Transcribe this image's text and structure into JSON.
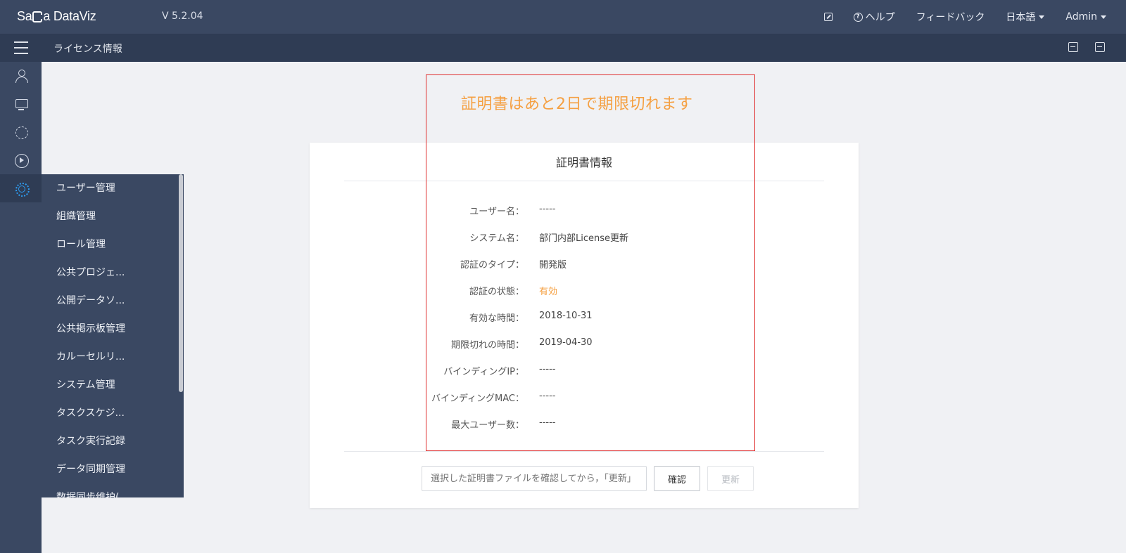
{
  "header": {
    "logo_text_pre": "Sa",
    "logo_text_post": "a DataViz",
    "version": "V 5.2.04",
    "help": "ヘルプ",
    "feedback": "フィードバック",
    "language": "日本語",
    "user": "Admin"
  },
  "subheader": {
    "breadcrumb": "ライセンス情報"
  },
  "rail": {
    "icons": [
      "user-icon",
      "monitor-icon",
      "cycle-icon",
      "play-icon",
      "gear-icon"
    ],
    "active": "gear-icon",
    "accent_color": "#2e9cf0"
  },
  "submenu": {
    "items": [
      "ユーザー管理",
      "組織管理",
      "ロール管理",
      "公共プロジェ...",
      "公開データソ...",
      "公共掲示板管理",
      "カルーセルリ...",
      "システム管理",
      "タスクスケジ...",
      "タスク実行記録",
      "データ同期管理",
      "数据同步维护(..."
    ]
  },
  "warning": {
    "text": "証明書はあと2日で期限切れます",
    "color": "#f5a042"
  },
  "certificate": {
    "title": "証明書情報",
    "rows": [
      {
        "label": "ユーザー名：",
        "value": "-----"
      },
      {
        "label": "システム名：",
        "value": "部门内部License更新"
      },
      {
        "label": "認証のタイプ：",
        "value": "開発版"
      },
      {
        "label": "認証の状態：",
        "value": "有効"
      },
      {
        "label": "有効な時間：",
        "value": "2018-10-31"
      },
      {
        "label": "期限切れの時間：",
        "value": "2019-04-30"
      },
      {
        "label": "バインディングIP：",
        "value": "-----"
      },
      {
        "label": "バインディングMAC：",
        "value": "-----"
      },
      {
        "label": "最大ユーザー数：",
        "value": "-----"
      }
    ],
    "file_placeholder": "選択した証明書ファイルを確認してから，「更新」",
    "confirm_label": "確認",
    "update_label": "更新"
  }
}
